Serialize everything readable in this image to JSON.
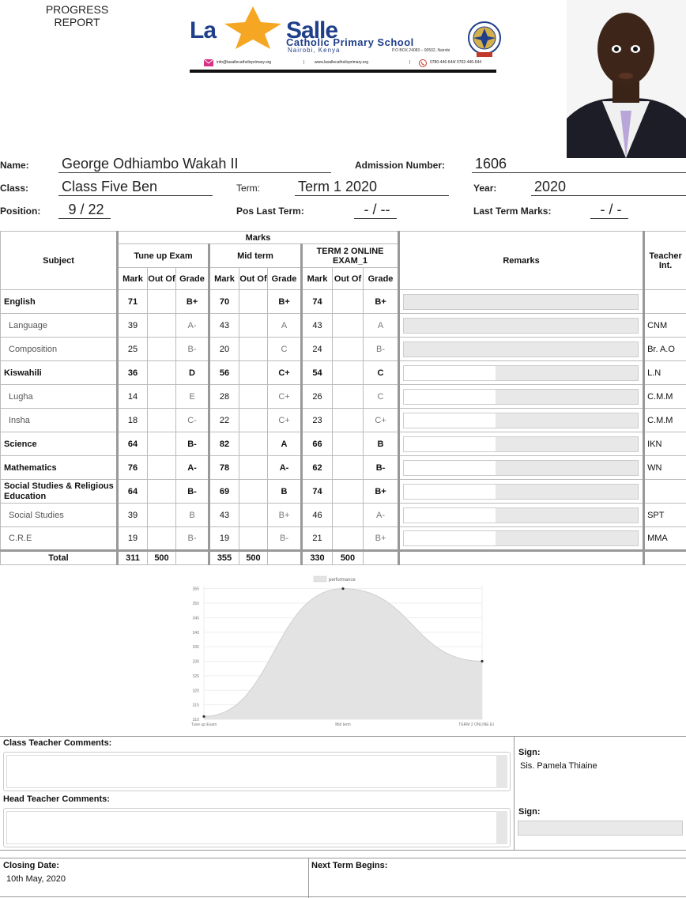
{
  "header": {
    "report_title_line1": "PROGRESS",
    "report_title_line2": "REPORT",
    "school_la": "La",
    "school_salle": "Salle",
    "school_name": "Catholic Primary School",
    "school_city": "Nairobi, Kenya",
    "school_pobox": "P.O BOX 24083 – 00502, Nairobi",
    "school_email": "info@lasallecatholicprimary.org",
    "school_website": "www.lasallecatholicprimary.org",
    "school_phone": "0780-446-644/ 0702-446-644",
    "divider1": "|",
    "divider2": "|"
  },
  "student": {
    "name_label": "Name:",
    "name": "George Odhiambo Wakah II",
    "admission_label": "Admission Number:",
    "admission": "1606",
    "class_label": "Class:",
    "class": "Class Five Ben",
    "term_label": "Term:",
    "term": "Term 1 2020",
    "year_label": "Year:",
    "year": "2020",
    "position_label": "Position:",
    "position": "9 / 22",
    "pos_last_label": "Pos Last Term:",
    "pos_last": "- / --",
    "last_marks_label": "Last Term Marks:",
    "last_marks": "- / -"
  },
  "table": {
    "subject_header": "Subject",
    "marks_header": "Marks",
    "exams": [
      "Tune up Exam",
      "Mid term",
      "TERM 2 ONLINE EXAM_1"
    ],
    "mark_col": "Mark",
    "outof_col": "Out Of",
    "grade_col": "Grade",
    "remarks_header": "Remarks",
    "teacher_header": "Teacher Int.",
    "rows": [
      {
        "subject": "English",
        "type": "main",
        "m1": "71",
        "g1": "B+",
        "m2": "70",
        "g2": "B+",
        "m3": "74",
        "g3": "B+",
        "teacher": "",
        "remark_fill": 1.0
      },
      {
        "subject": "Language",
        "type": "sub",
        "m1": "39",
        "g1": "A-",
        "m2": "43",
        "g2": "A",
        "m3": "43",
        "g3": "A",
        "teacher": "CNM",
        "remark_fill": 1.0
      },
      {
        "subject": "Composition",
        "type": "sub",
        "m1": "25",
        "g1": "B-",
        "m2": "20",
        "g2": "C",
        "m3": "24",
        "g3": "B-",
        "teacher": "Br. A.O",
        "remark_fill": 1.0
      },
      {
        "subject": "Kiswahili",
        "type": "main",
        "m1": "36",
        "g1": "D",
        "m2": "56",
        "g2": "C+",
        "m3": "54",
        "g3": "C",
        "teacher": "L.N",
        "remark_fill": 0.61
      },
      {
        "subject": "Lugha",
        "type": "sub",
        "m1": "14",
        "g1": "E",
        "m2": "28",
        "g2": "C+",
        "m3": "26",
        "g3": "C",
        "teacher": "C.M.M",
        "remark_fill": 0.61
      },
      {
        "subject": "Insha",
        "type": "sub",
        "m1": "18",
        "g1": "C-",
        "m2": "22",
        "g2": "C+",
        "m3": "23",
        "g3": "C+",
        "teacher": "C.M.M",
        "remark_fill": 0.61
      },
      {
        "subject": "Science",
        "type": "main",
        "m1": "64",
        "g1": "B-",
        "m2": "82",
        "g2": "A",
        "m3": "66",
        "g3": "B",
        "teacher": "IKN",
        "remark_fill": 0.61
      },
      {
        "subject": "Mathematics",
        "type": "main",
        "m1": "76",
        "g1": "A-",
        "m2": "78",
        "g2": "A-",
        "m3": "62",
        "g3": "B-",
        "teacher": "WN",
        "remark_fill": 0.61
      },
      {
        "subject": "Social Studies & Religious Education",
        "type": "main",
        "m1": "64",
        "g1": "B-",
        "m2": "69",
        "g2": "B",
        "m3": "74",
        "g3": "B+",
        "teacher": "",
        "remark_fill": 0.61
      },
      {
        "subject": "Social Studies",
        "type": "sub",
        "m1": "39",
        "g1": "B",
        "m2": "43",
        "g2": "B+",
        "m3": "46",
        "g3": "A-",
        "teacher": "SPT",
        "remark_fill": 0.61
      },
      {
        "subject": "C.R.E",
        "type": "sub",
        "m1": "19",
        "g1": "B-",
        "m2": "19",
        "g2": "B-",
        "m3": "21",
        "g3": "B+",
        "teacher": "MMA",
        "remark_fill": 0.61
      }
    ],
    "total": {
      "label": "Total",
      "m1": "311",
      "o1": "500",
      "m2": "355",
      "o2": "500",
      "m3": "330",
      "o3": "500"
    }
  },
  "chart_data": {
    "type": "area",
    "categories": [
      "Tune up Exam",
      "Mid term",
      "TERM 2 ONLINE EXAM_1"
    ],
    "series": [
      {
        "name": "performance",
        "values": [
          311,
          355,
          330
        ]
      }
    ],
    "yticks": [
      "355",
      "350",
      "345",
      "340",
      "335",
      "330",
      "325",
      "320",
      "315",
      "310"
    ],
    "ylim": [
      310,
      356
    ],
    "grid": true,
    "legend": "top-center",
    "fill_color": "#e3e3e3",
    "line_color": "#d0d0d0"
  },
  "comments": {
    "class_teacher_label": "Class Teacher Comments:",
    "head_teacher_label": "Head Teacher Comments:",
    "sign_label_1": "Sign:",
    "sign_value_1": "Sis. Pamela Thiaine",
    "sign_label_2": "Sign:"
  },
  "footer": {
    "closing_label": "Closing Date:",
    "closing_value": "10th May, 2020",
    "next_term_label": "Next Term Begins:"
  }
}
